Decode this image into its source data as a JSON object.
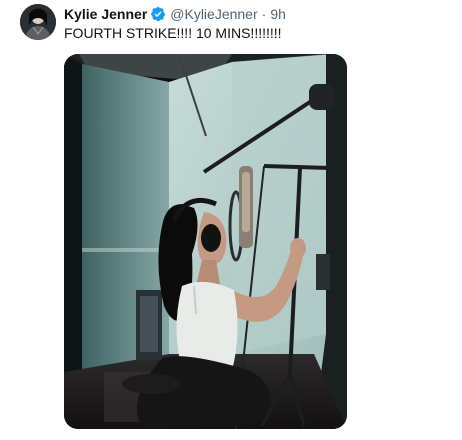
{
  "tweet": {
    "author": {
      "display_name": "Kylie Jenner",
      "handle": "@KylieJenner",
      "verified": true,
      "avatar_icon": "profile-avatar"
    },
    "separator": "·",
    "timestamp": "9h",
    "text": "FOURTH STRIKE!!!! 10 MINS!!!!!!!!",
    "media": {
      "type": "photo",
      "icon": "studio-photo"
    }
  },
  "colors": {
    "name_text": "#0f1419",
    "secondary_text": "#536471",
    "verified_badge": "#1d9bf0",
    "background": "#ffffff"
  }
}
